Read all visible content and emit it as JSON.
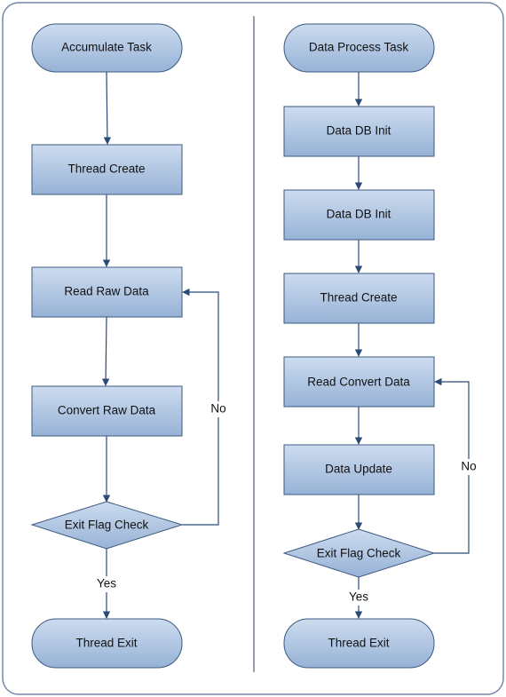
{
  "colors": {
    "shape_fill_top": "#c9d8ec",
    "shape_fill_bottom": "#98b3d6",
    "stroke": "#3d5a80",
    "connector": "#2c4a78"
  },
  "left": {
    "start": "Accumulate Task",
    "step1": "Thread Create",
    "step2": "Read Raw Data",
    "step3": "Convert Raw Data",
    "decision": "Exit Flag Check",
    "yes": "Yes",
    "no": "No",
    "end": "Thread Exit"
  },
  "right": {
    "start": "Data Process Task",
    "step1": "Data DB Init",
    "step2": "Data DB Init",
    "step3": "Thread Create",
    "step4": "Read Convert Data",
    "step5": "Data Update",
    "decision": "Exit Flag Check",
    "yes": "Yes",
    "no": "No",
    "end": "Thread Exit"
  }
}
